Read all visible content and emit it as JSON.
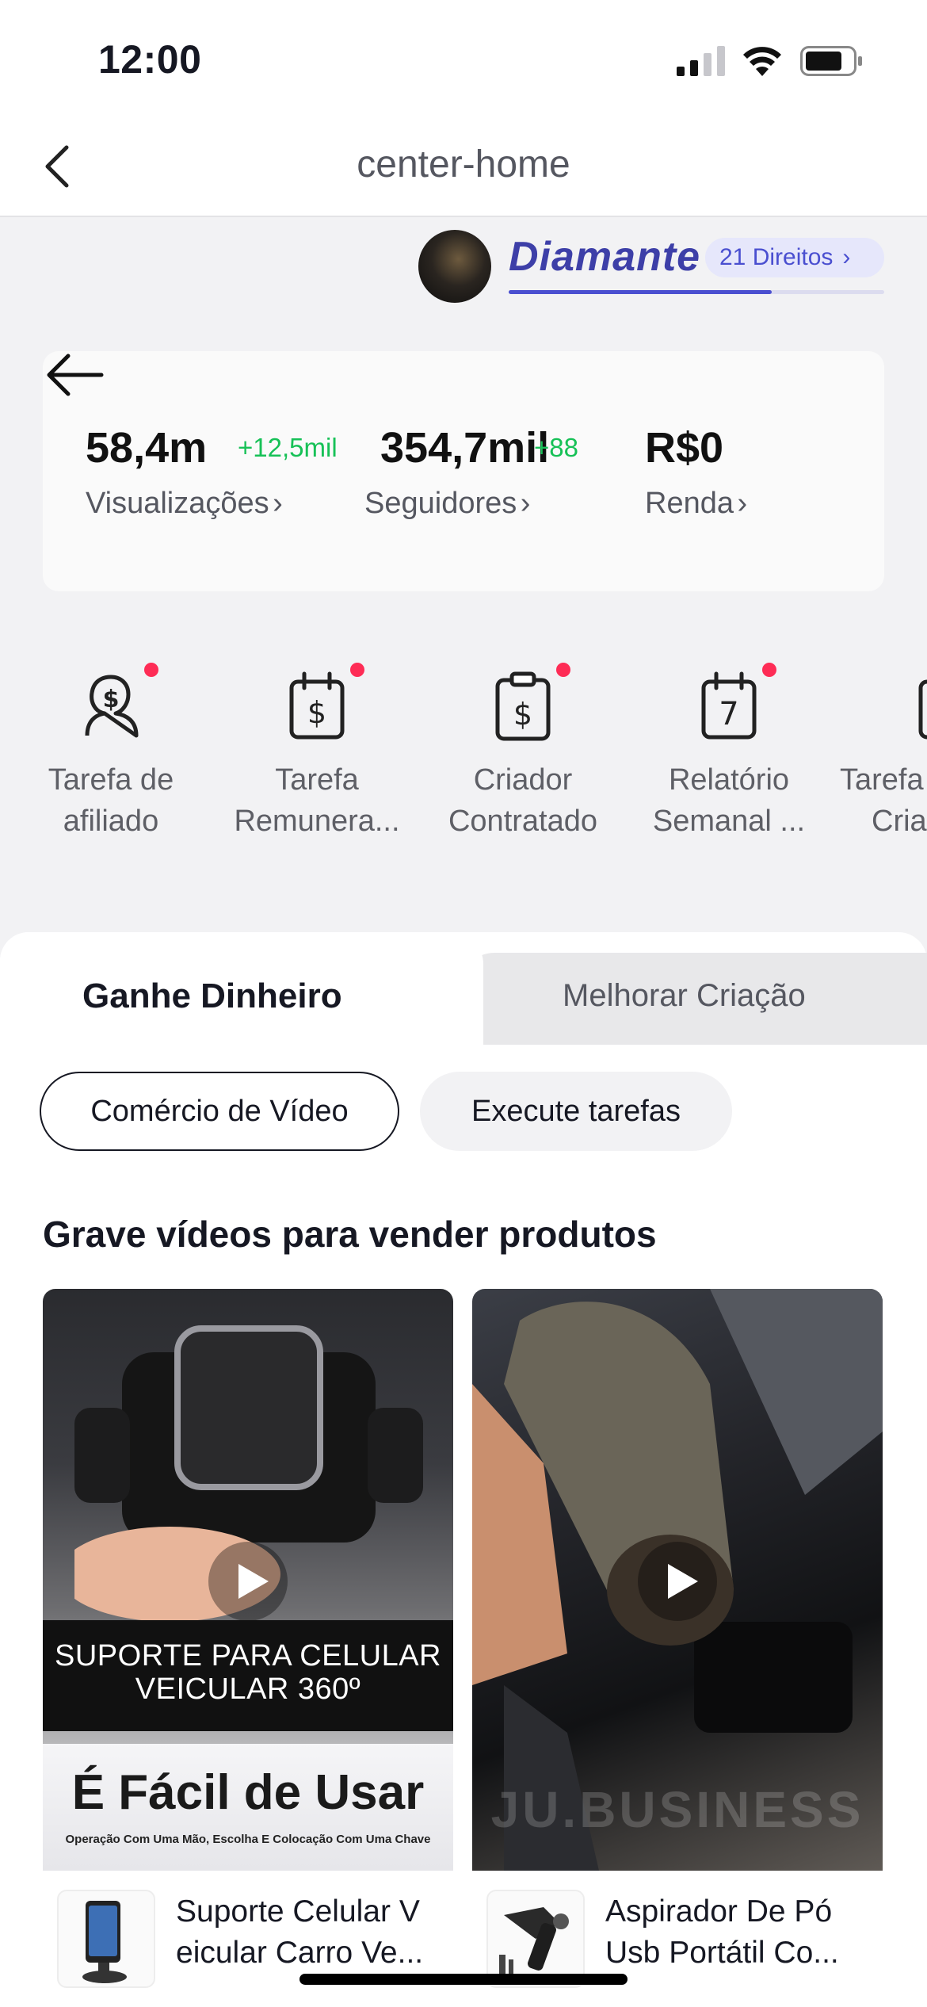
{
  "status_bar": {
    "time": "12:00"
  },
  "nav": {
    "title": "center-home"
  },
  "tier": {
    "name": "Diamante",
    "rights_label": "21 Direitos",
    "progress": 0.7
  },
  "stats": [
    {
      "value": "58,4m",
      "delta": "+12,5mil",
      "label": "Visualizações"
    },
    {
      "value": "354,7mil",
      "delta": "+88",
      "label": "Seguidores"
    },
    {
      "value": "R$0",
      "delta": "",
      "label": "Renda"
    }
  ],
  "shortcuts": [
    {
      "icon": "affiliate-icon",
      "line1": "Tarefa de",
      "line2": "afiliado",
      "dot": true
    },
    {
      "icon": "paid-task-icon",
      "line1": "Tarefa",
      "line2": "Remunera...",
      "dot": true
    },
    {
      "icon": "hired-creator-icon",
      "line1": "Criador",
      "line2": "Contratado",
      "dot": true
    },
    {
      "icon": "weekly-report-icon",
      "line1": "Relatório",
      "line2": "Semanal ...",
      "dot": true
    },
    {
      "icon": "creator-task-icon",
      "line1": "Tarefa",
      "line2": "Cria",
      "dot": false
    }
  ],
  "tabs": {
    "active": "Ganhe Dinheiro",
    "inactive": "Melhorar Criação"
  },
  "chips": {
    "active": "Comércio de Vídeo",
    "inactive": "Execute tarefas"
  },
  "section": {
    "title": "Grave vídeos para vender produtos"
  },
  "products": [
    {
      "banner_line1": "SUPORTE PARA CELULAR",
      "banner_line2": "VEICULAR 360º",
      "easy_title": "É Fácil de Usar",
      "easy_sub": "Operação Com Uma Mão, Escolha E Colocação Com Uma Chave",
      "name_line1": "Suporte Celular V",
      "name_line2": "eicular Carro Ve..."
    },
    {
      "watermark": "JU.BUSINESS",
      "name_line1": "Aspirador De Pó",
      "name_line2": "Usb Portátil Co..."
    }
  ],
  "colors": {
    "accent_green": "#17c157",
    "tier_blue": "#4a4fd0",
    "badge_red": "#fe2c55"
  }
}
